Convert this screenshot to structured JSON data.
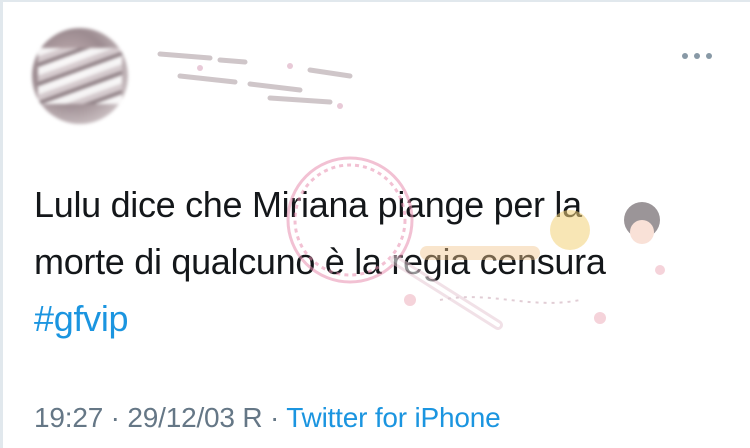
{
  "tweet": {
    "text_lines": [
      "Lulu dice che Miriana piange per la",
      "morte di qualcuno è la regia censura"
    ],
    "hashtag": "#gfvip",
    "time": "19:27",
    "separator": "·",
    "date": "29/12/03 R",
    "source": "Twitter for iPhone"
  },
  "icons": {
    "more": "more-options-icon"
  },
  "colors": {
    "text": "#14171a",
    "link": "#1b95e0",
    "meta": "#657786",
    "watermark": "#e88fb0"
  }
}
